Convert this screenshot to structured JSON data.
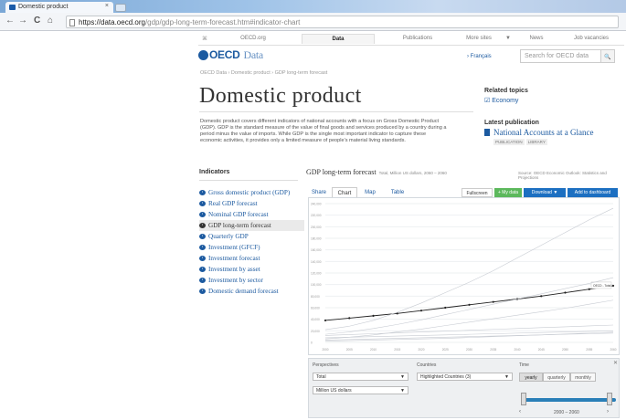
{
  "browser": {
    "tab_title": "Domestic product",
    "tab_close": "×",
    "url_domain": "https://data.oecd.org",
    "url_path": "/gdp/gdp-long-term-forecast.htm#indicator-chart",
    "back": "←",
    "forward": "→",
    "reload": "C",
    "home": "⌂"
  },
  "site_nav": {
    "items": [
      "OECD.org",
      "Data",
      "Publications",
      "More sites",
      "News",
      "Job vacancies"
    ],
    "active": "Data",
    "more_caret": "▼"
  },
  "header": {
    "logo_text": "OECD",
    "logo_sub": "Data",
    "language_link": "› Français",
    "search_placeholder": "Search for OECD data",
    "search_icon": "search-icon",
    "search_glyph": "🔍"
  },
  "breadcrumb": "OECD Data › Domestic product › GDP long-term forecast",
  "page_title": "Domestic product",
  "description": "Domestic product covers different indicators of national accounts with a focus on Gross Domestic Product (GDP). GDP is the standard measure of the value of final goods and services produced by a country during a period minus the value of imports. While GDP is the single most important indicator to capture these economic activities, it provides only a limited measure of people's material living standards.",
  "related": {
    "heading": "Related topics",
    "link": "Economy",
    "link_glyph": "☑"
  },
  "latest": {
    "heading": "Latest publication",
    "title": "National Accounts at a Glance",
    "tags": [
      "PUBLICATION",
      "LIBRARY"
    ]
  },
  "indicators": {
    "heading": "Indicators",
    "items": [
      "Gross domestic product (GDP)",
      "Real GDP forecast",
      "Nominal GDP forecast",
      "GDP long-term forecast",
      "Quarterly GDP",
      "Investment (GFCF)",
      "Investment forecast",
      "Investment by asset",
      "Investment by sector",
      "Domestic demand forecast"
    ],
    "selected_index": 3,
    "arrow_glyph": "›"
  },
  "chart_panel": {
    "title": "GDP long-term forecast",
    "unit_note": "Total, Million US dollars, 2060 – 2060",
    "source": "Source: OECD Economic Outlook: Statistics and Projections",
    "tabs": [
      "Share",
      "Chart",
      "Map",
      "Table"
    ],
    "active_tab": "Chart",
    "tools": {
      "fullscreen": "Fullscreen",
      "mydata": "+ My data",
      "download": "Download ▼",
      "dashboard": "Add to dashboard"
    },
    "highlight_label": "OECD - Total",
    "colors": {
      "highlight": "#222222",
      "other_lines": "#c7cbd2",
      "grid": "#eef0f2",
      "green": "#5cb85c",
      "blue": "#1c6fc1"
    }
  },
  "chart_data": {
    "type": "line",
    "x": [
      2000,
      2005,
      2010,
      2015,
      2020,
      2025,
      2030,
      2035,
      2040,
      2045,
      2050,
      2055,
      2060
    ],
    "x_ticks": [
      "2000",
      "2005",
      "2010",
      "2015",
      "2020",
      "2025",
      "2030",
      "2035",
      "2040",
      "2045",
      "2050",
      "2055",
      "2060"
    ],
    "y_ticks": [
      "0",
      "20,000",
      "40,000",
      "60,000",
      "80,000",
      "100,000",
      "120,000",
      "140,000",
      "160,000",
      "180,000",
      "200,000",
      "220,000",
      "240,000"
    ],
    "ylim": [
      0,
      240000
    ],
    "series": [
      {
        "name": "OECD - Total",
        "highlight": true,
        "values": [
          38000,
          42000,
          46000,
          50000,
          55000,
          60000,
          65000,
          70000,
          75000,
          80000,
          86000,
          92000,
          98000
        ]
      },
      {
        "values": [
          22000,
          28000,
          38000,
          52000,
          68000,
          86000,
          104000,
          124000,
          146000,
          168000,
          190000,
          212000,
          232000
        ]
      },
      {
        "values": [
          14000,
          18000,
          24000,
          31000,
          39000,
          48000,
          57000,
          66000,
          75000,
          84000,
          93000,
          102000,
          112000
        ]
      },
      {
        "values": [
          6000,
          9000,
          13000,
          18000,
          23000,
          29000,
          35000,
          41000,
          47000,
          53000,
          59000,
          66000,
          73000
        ]
      },
      {
        "values": [
          12000,
          13500,
          15000,
          16500,
          18000,
          19500,
          21000,
          22500,
          24000,
          25500,
          27000,
          28500,
          30000
        ]
      },
      {
        "values": [
          8000,
          9000,
          10000,
          11000,
          12000,
          13000,
          14000,
          15000,
          16000,
          17000,
          18000,
          19000,
          20000
        ]
      },
      {
        "values": [
          4000,
          5000,
          6000,
          7000,
          8000,
          9000,
          10000,
          11000,
          12000,
          13000,
          14000,
          15000,
          16000
        ]
      },
      {
        "values": [
          2000,
          3000,
          4000,
          5000,
          6000,
          7000,
          8500,
          10000,
          11500,
          13000,
          14500,
          16000,
          17500
        ]
      }
    ],
    "grid": true
  },
  "controls": {
    "perspectives_label": "Perspectives",
    "total_select": "Total",
    "unit_select": "Million US dollars",
    "countries_label": "Countries",
    "countries_select": "Highlighted Countries (3)",
    "time_label": "Time",
    "time_options": [
      "yearly",
      "quarterly",
      "monthly"
    ],
    "time_active": "yearly",
    "range_text": "2000 – 2060",
    "prev": "‹",
    "next": "›",
    "caret": "▼",
    "close": "✕"
  }
}
